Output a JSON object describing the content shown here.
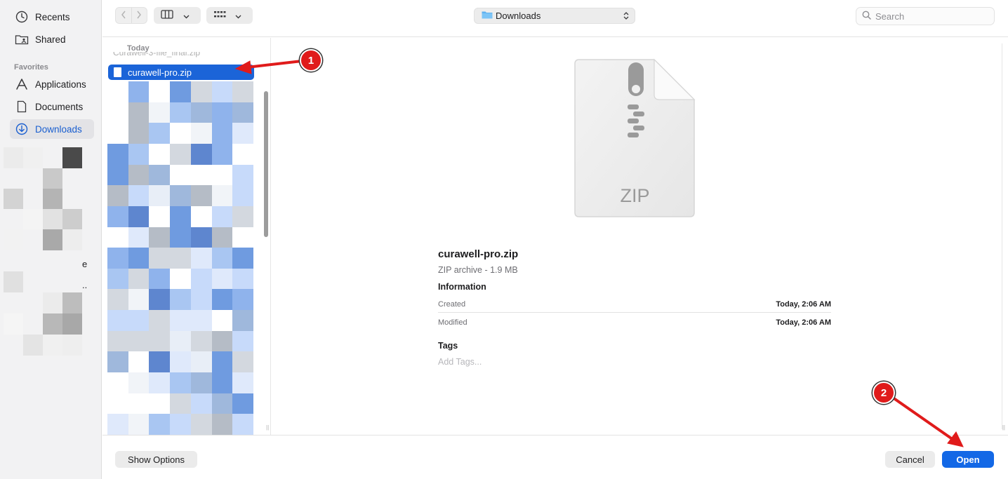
{
  "sidebar": {
    "items": [
      {
        "label": "Recents",
        "icon": "clock-icon"
      },
      {
        "label": "Shared",
        "icon": "shared-folder-icon"
      }
    ],
    "favorites_header": "Favorites",
    "favorites": [
      {
        "label": "Applications",
        "icon": "applications-icon"
      },
      {
        "label": "Documents",
        "icon": "document-icon"
      },
      {
        "label": "Downloads",
        "icon": "download-icon",
        "selected": true
      }
    ],
    "blurred_fragments": [
      "e",
      ".."
    ]
  },
  "toolbar": {
    "back_icon": "chevron-left-icon",
    "forward_icon": "chevron-right-icon",
    "view_icon": "columns-view-icon",
    "group_icon": "grid-icon",
    "location": "Downloads",
    "search_placeholder": "Search"
  },
  "file_column": {
    "section_header": "Today",
    "ghost_text": "Curawell-3-file_final.zip",
    "selected_file": "curawell-pro.zip"
  },
  "preview": {
    "icon_label": "ZIP",
    "file_name": "curawell-pro.zip",
    "kind_size": "ZIP archive - 1.9 MB",
    "information_header": "Information",
    "info_rows": [
      {
        "label": "Created",
        "value": "Today, 2:06 AM"
      },
      {
        "label": "Modified",
        "value": "Today, 2:06 AM"
      }
    ],
    "tags_header": "Tags",
    "tags_placeholder": "Add Tags..."
  },
  "footer": {
    "show_options": "Show Options",
    "cancel": "Cancel",
    "open": "Open"
  },
  "annotations": {
    "badge_1": "1",
    "badge_2": "2",
    "color": "#e01b1b"
  },
  "colors": {
    "accent": "#1368e6",
    "selection": "#1b64d8"
  }
}
